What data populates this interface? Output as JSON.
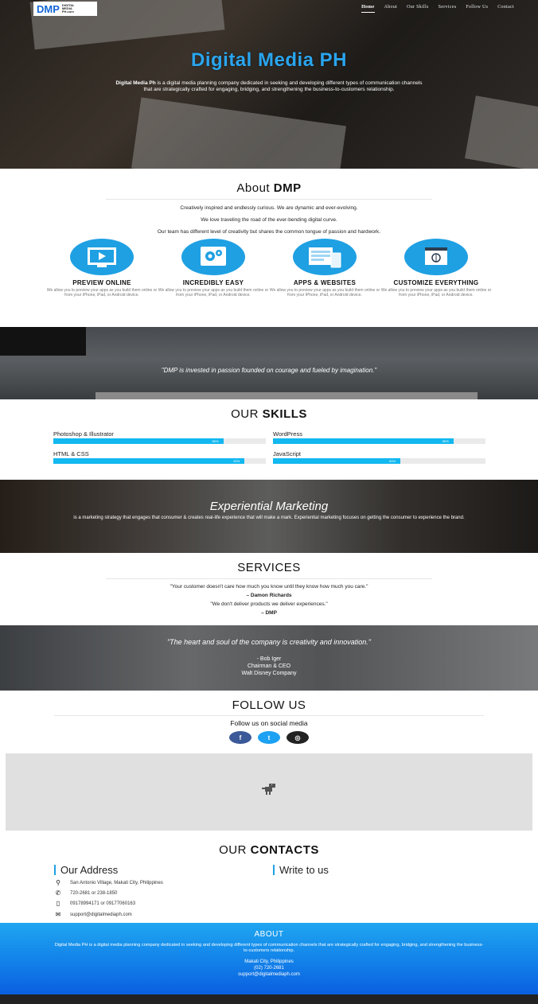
{
  "logo": {
    "main": "DMP",
    "sub_line1": "DIGITAL",
    "sub_line2": "MEDIA",
    "sub_line3": "PH.com"
  },
  "nav": [
    "Home",
    "About",
    "Our Skills",
    "Services",
    "Follow Us",
    "Contact"
  ],
  "hero": {
    "title": "Digital Media PH",
    "bold": "Digital Media Ph",
    "text": " is a digital media planning company dedicated in seeking and developing different types of communication channels that are strategically crafted for engaging, bridging, and strengthening the business-to-customers relationship."
  },
  "about": {
    "title_plain": "About ",
    "title_bold": "DMP",
    "lines": [
      "Creatively inspired and endlessly curious. We are dynamic and ever-evolving.",
      "We love traveling the road of the ever-bending digital curve.",
      "Our team has different level of creativity but shares the common tongue of passion and hardwork."
    ],
    "features": [
      {
        "title": "PREVIEW ONLINE",
        "desc": "We allow you to preview your apps as you build them online or from your iPhone, iPad, or Android device.",
        "icon": "monitor-play-icon"
      },
      {
        "title": "INCREDIBLY EASY",
        "desc": "We allow you to preview your apps as you build them online or from your iPhone, iPad, or Android device.",
        "icon": "gears-icon"
      },
      {
        "title": "APPS & WEBSITES",
        "desc": "We allow you to preview your apps as you build them online or from your iPhone, iPad, or Android device.",
        "icon": "devices-icon"
      },
      {
        "title": "CUSTOMIZE EVERYTHING",
        "desc": "We allow you to preview your apps as you build them online or from your iPhone, iPad, or Android device.",
        "icon": "pen-tool-icon"
      }
    ]
  },
  "quote1": "\"DMP is invested in passion founded on courage and fueled by imagination.\"",
  "skills": {
    "title_plain": "OUR ",
    "title_bold": "SKILLS",
    "items": [
      {
        "name": "Photoshop & Illustrator",
        "value": 80,
        "label": "80%"
      },
      {
        "name": "WordPress",
        "value": 85,
        "label": "85%"
      },
      {
        "name": "HTML & CSS",
        "value": 90,
        "label": "90%"
      },
      {
        "name": "JavaScript",
        "value": 60,
        "label": "60%"
      }
    ],
    "bar_color": "#12b8ef"
  },
  "experiential": {
    "title": "Experiential Marketing",
    "text": "is a marketing strategy that engages that consumer & creates real-life experience that will make a mark. Experiential marketing focuses on getting the consumer to experience the brand."
  },
  "services": {
    "title": "SERVICES",
    "quote1": "\"Your customer doesn't care how much you know until they know how much you care.\"",
    "author1": "– Damon Richards",
    "quote2": "\"We don't deliver products we deliver experiences.\"",
    "author2": "– DMP"
  },
  "quote2": {
    "text": "\"The heart and soul of the company is creativity and innovation.\"",
    "author": "- Bob Iger",
    "role": "Chairman & CEO",
    "company": "Walt Disney Company"
  },
  "follow": {
    "title": "FOLLOW US",
    "subtitle": "Follow us on social media",
    "icons": [
      {
        "name": "facebook-icon",
        "glyph": "f",
        "color": "#3b5998"
      },
      {
        "name": "twitter-icon",
        "glyph": "t",
        "color": "#1da1f2"
      },
      {
        "name": "instagram-icon",
        "glyph": "◎",
        "color": "#222222"
      }
    ]
  },
  "contacts": {
    "title_plain": "OUR ",
    "title_bold": "CONTACTS",
    "address_heading": "Our Address",
    "write_heading": "Write to us",
    "rows": [
      {
        "icon": "location-pin-icon",
        "glyph": "⚲",
        "text": "San Antonio Village, Makati City, Philippines"
      },
      {
        "icon": "phone-icon",
        "glyph": "✆",
        "text": "720-2681 or 238-1850"
      },
      {
        "icon": "mobile-icon",
        "glyph": "▯",
        "text": "09178994171 or 09177060163"
      },
      {
        "icon": "envelope-icon",
        "glyph": "✉",
        "text": "support@digitalmediaph.com"
      }
    ]
  },
  "footer": {
    "title": "ABOUT",
    "text": "Digital Media PH is a digital media planning company dedicated in seeking and developing different types of communication channels that are strategically crafted for engaging, bridging, and strengthening the business-to-customers relationship.",
    "city": "Makati City, Philippines",
    "phone": "(02) 720-2681",
    "email": "support@digitalmediaph.com"
  }
}
